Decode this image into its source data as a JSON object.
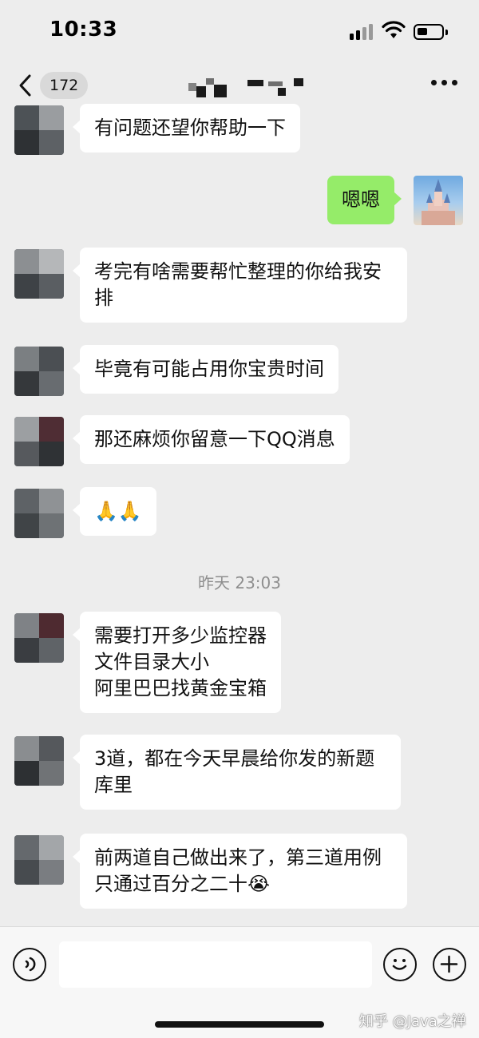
{
  "status_bar": {
    "time": "10:33",
    "icons": [
      "signal-icon",
      "wifi-icon",
      "battery-icon"
    ]
  },
  "nav": {
    "back_icon": "chevron-left-icon",
    "unread_count": "172",
    "more_icon": "more-dots-icon"
  },
  "messages": [
    {
      "side": "left",
      "text": "有问题还望你帮助一下"
    },
    {
      "side": "right",
      "text": "嗯嗯"
    },
    {
      "side": "left",
      "text": "考完有啥需要帮忙整理的你给我安排"
    },
    {
      "side": "left",
      "text": "毕竟有可能占用你宝贵时间"
    },
    {
      "side": "left",
      "text": "那还麻烦你留意一下QQ消息"
    },
    {
      "side": "left",
      "text": "🙏🙏"
    },
    {
      "side": "left",
      "text": "需要打开多少监控器\n文件目录大小\n阿里巴巴找黄金宝箱"
    },
    {
      "side": "left",
      "text": "3道，都在今天早晨给你发的新题库里"
    },
    {
      "side": "left",
      "text": "前两道自己做出来了，第三道用例只通过百分之二十😭"
    }
  ],
  "timestamp": "昨天 23:03",
  "input_bar": {
    "voice_icon": "voice-icon",
    "emoji_icon": "emoji-icon",
    "plus_icon": "plus-icon"
  },
  "watermark": "知乎 @Java之禅",
  "colors": {
    "background": "#ededed",
    "incoming_bubble": "#ffffff",
    "outgoing_bubble": "#95ec69"
  }
}
